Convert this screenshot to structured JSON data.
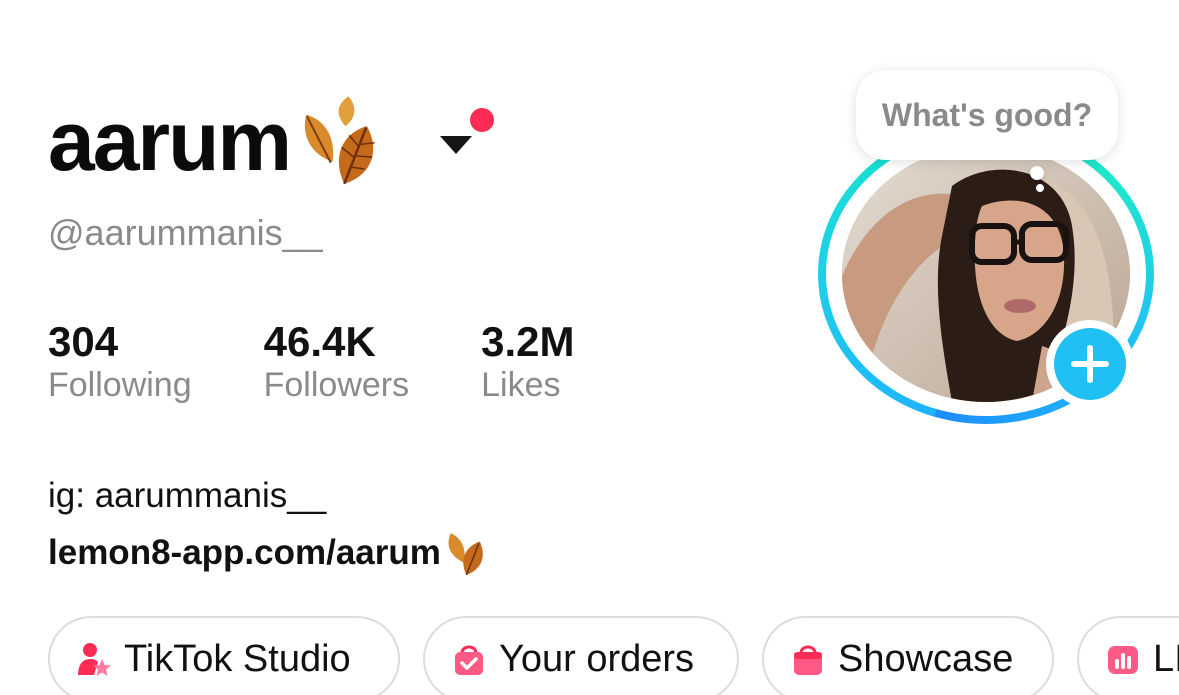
{
  "profile": {
    "display_name": "aarum",
    "handle": "@aarummanis__",
    "bio_line": "ig: aarummanis__",
    "bio_link": "lemon8-app.com/aarum"
  },
  "stats": [
    {
      "value": "304",
      "label": "Following"
    },
    {
      "value": "46.4K",
      "label": "Followers"
    },
    {
      "value": "3.2M",
      "label": "Likes"
    }
  ],
  "bubble": {
    "text": "What's good?"
  },
  "pills": [
    {
      "label": "TikTok Studio",
      "icon": "tiktok-studio-icon"
    },
    {
      "label": "Your orders",
      "icon": "shopping-bag-check-icon"
    },
    {
      "label": "Showcase",
      "icon": "shopping-bag-icon"
    },
    {
      "label": "LI",
      "icon": "analytics-icon"
    }
  ],
  "colors": {
    "notification_dot": "#fe2c55",
    "add_button": "#20c0f4",
    "pill_icon_pink": "#fe2c55",
    "ring_start": "#1d8cff",
    "ring_end": "#13e8c5"
  }
}
